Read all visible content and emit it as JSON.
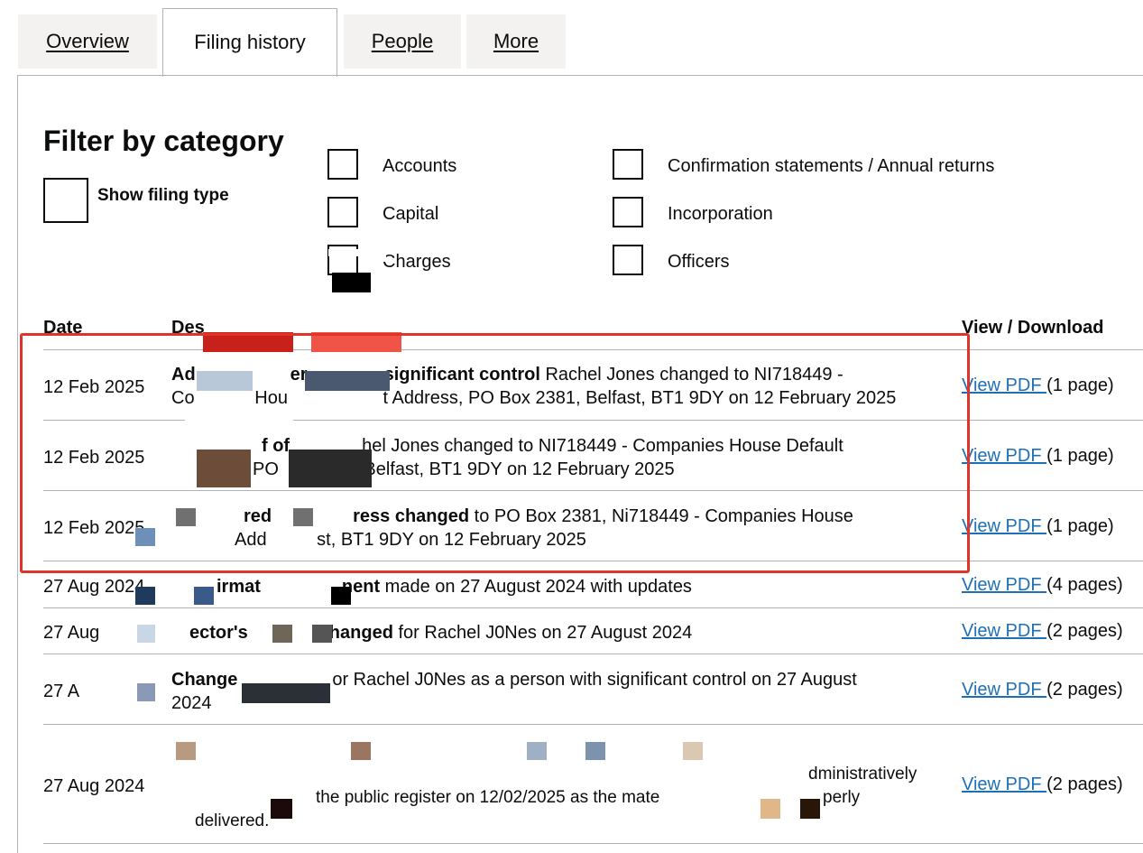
{
  "tabs": {
    "overview": "Overview",
    "filing_history": "Filing history",
    "people": "People",
    "more": "More"
  },
  "filter": {
    "title": "Filter by category",
    "show_filing_type": "Show filing type",
    "categories": [
      {
        "label": "Accounts",
        "checked": false
      },
      {
        "label": "Capital",
        "checked": false
      },
      {
        "label": "Charges",
        "checked": false
      },
      {
        "label": "Confirmation statements / Annual returns",
        "checked": false
      },
      {
        "label": "Incorporation",
        "checked": false
      },
      {
        "label": "Officers",
        "checked": false
      }
    ]
  },
  "table": {
    "headers": {
      "date": "Date",
      "description": "Des",
      "view": "View / Download"
    },
    "rows": [
      {
        "date": "12 Feb 2025",
        "line1_bold_a": "Ad",
        "line1_bold_b": "er",
        "line1_bold_c": "significant control",
        "line1_rest": " Rachel Jones changed to NI718449 -",
        "line2": "Co            Hou                   t Address, PO Box 2381, Belfast, BT1 9DY on 12 February 2025",
        "link": "View PDF ",
        "pages": "(1 page)"
      },
      {
        "date": "12 Feb 2025",
        "line1_bold": "f of",
        "line1_rest": "hel Jones changed to NI718449 - Companies House Default",
        "line2": "PO                 Belfast, BT1 9DY on 12 February 2025",
        "link": "View PDF ",
        "pages": "(1 page)"
      },
      {
        "date": "12 Feb 2025",
        "line1_bold_a": "red",
        "line1_bold_b": "ress changed",
        "line1_rest": " to PO Box 2381, Ni718449 - Companies House",
        "line2": "Add          st, BT1 9DY on 12 February 2025",
        "link": "View PDF ",
        "pages": "(1 page)"
      },
      {
        "date": "27 Aug 2024",
        "bold": "irmat",
        "bold_b": "nent",
        "rest": " made on 27 August 2024 with updates",
        "link": "View PDF ",
        "pages": "(4 pages)"
      },
      {
        "date": "27 Aug",
        "bold": "ector's",
        "bold_b": "hanged",
        "rest": " for Rachel J0Nes on 27 August 2024",
        "link": "View PDF ",
        "pages": "(2 pages)"
      },
      {
        "date": "27 A",
        "bold": "Change",
        "rest": "or Rachel J0Nes as a person with significant control on 27 August",
        "line2": "2024",
        "link": "View PDF ",
        "pages": "(2 pages)"
      },
      {
        "date": "27 Aug 2024",
        "line1": "dministratively",
        "line2a": "the public register on 12/02/2025 as the mate",
        "line2b": "perly",
        "line3": "delivered.",
        "link": "View PDF ",
        "pages": "(2 pages)"
      }
    ]
  },
  "colors": {
    "link": "#1d70b8",
    "highlight_box": "#e0342b",
    "tab_bg": "#f3f2f1",
    "border": "#b1b4b6"
  }
}
